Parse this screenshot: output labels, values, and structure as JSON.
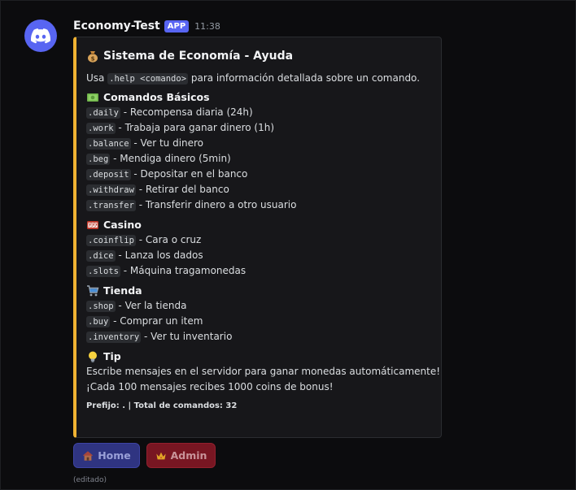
{
  "message": {
    "author": "Economy-Test",
    "tag": "APP",
    "timestamp": "11:38",
    "edited_label": "(editado)"
  },
  "embed": {
    "accent_color": "#f0b232",
    "title": "Sistema de Economía - Ayuda",
    "title_icon": "money-bag-icon",
    "description": {
      "prefix": "Usa ",
      "code": ".help <comando>",
      "suffix": " para información detallada sobre un comando."
    },
    "fields": [
      {
        "name": "Comandos Básicos",
        "icon": "dollar-banknote-icon",
        "lines": [
          {
            "cmd": ".daily",
            "text": " - Recompensa diaria (24h)"
          },
          {
            "cmd": ".work",
            "text": " - Trabaja para ganar dinero (1h)"
          },
          {
            "cmd": ".balance",
            "text": " - Ver tu dinero"
          },
          {
            "cmd": ".beg",
            "text": " - Mendiga dinero (5min)"
          },
          {
            "cmd": ".deposit",
            "text": " - Depositar en el banco"
          },
          {
            "cmd": ".withdraw",
            "text": " - Retirar del banco"
          },
          {
            "cmd": ".transfer",
            "text": " - Transferir dinero a otro usuario"
          }
        ]
      },
      {
        "name": "Casino",
        "icon": "slot-machine-icon",
        "lines": [
          {
            "cmd": ".coinflip",
            "text": " - Cara o cruz"
          },
          {
            "cmd": ".dice",
            "text": " - Lanza los dados"
          },
          {
            "cmd": ".slots",
            "text": " - Máquina tragamonedas"
          }
        ]
      },
      {
        "name": "Tienda",
        "icon": "shopping-cart-icon",
        "lines": [
          {
            "cmd": ".shop",
            "text": " - Ver la tienda"
          },
          {
            "cmd": ".buy",
            "text": " - Comprar un item"
          },
          {
            "cmd": ".inventory",
            "text": " - Ver tu inventario"
          }
        ]
      },
      {
        "name": "Tip",
        "icon": "light-bulb-icon",
        "lines": [
          {
            "cmd": "",
            "text": "Escribe mensajes en el servidor para ganar monedas automáticamente!"
          },
          {
            "cmd": "",
            "text": "¡Cada 100 mensajes recibes 1000 coins de bonus!"
          }
        ]
      }
    ],
    "footer": "Prefijo: . | Total de comandos: 32"
  },
  "buttons": {
    "home": {
      "label": "Home",
      "icon": "house-icon"
    },
    "admin": {
      "label": "Admin",
      "icon": "crown-icon"
    }
  }
}
